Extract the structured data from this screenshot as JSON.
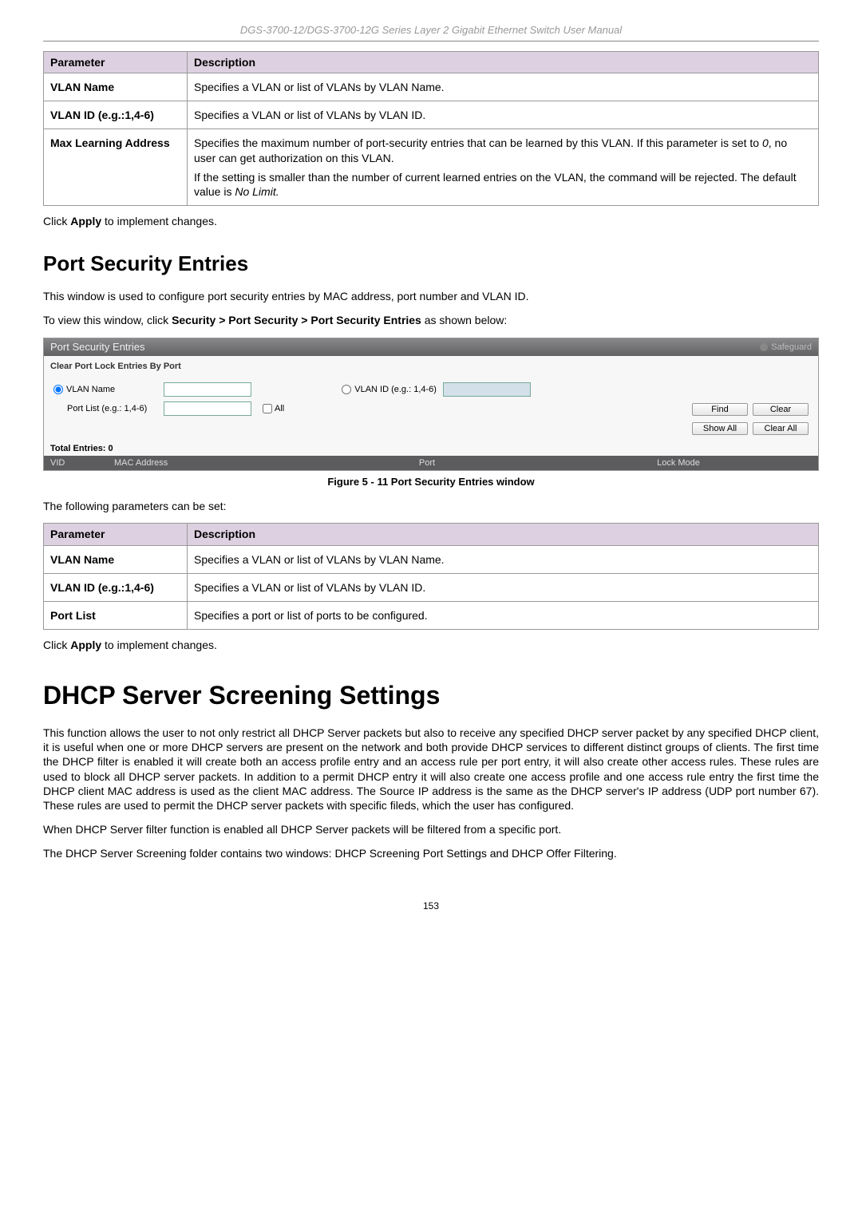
{
  "header": {
    "title": "DGS-3700-12/DGS-3700-12G Series Layer 2 Gigabit Ethernet Switch User Manual"
  },
  "table1": {
    "headers": {
      "p": "Parameter",
      "d": "Description"
    },
    "rows": [
      {
        "param": "VLAN Name",
        "desc1": "Specifies a VLAN or list of VLANs by VLAN Name."
      },
      {
        "param": "VLAN ID (e.g.:1,4-6)",
        "desc1": "Specifies a VLAN or list of VLANs by VLAN ID."
      },
      {
        "param": "Max Learning Address",
        "desc1": "Specifies the maximum number of port-security entries that can be learned by this VLAN. If this parameter is set to ",
        "desc1_italic": "0",
        "desc1_cont": ", no user can get authorization on this VLAN.",
        "desc2": "If the setting is smaller than the number of current learned entries on the VLAN, the command will be rejected. The default value is ",
        "desc2_italic": "No Limit."
      }
    ]
  },
  "apply_text": {
    "pre": "Click ",
    "bold": "Apply",
    "post": " to implement changes."
  },
  "section1": {
    "heading": "Port Security Entries",
    "intro": "This window is used to configure port security entries by MAC address, port number and VLAN ID.",
    "nav_pre": "To view this window, click ",
    "nav_bold": "Security > Port Security > Port Security Entries",
    "nav_post": " as shown below:"
  },
  "ui": {
    "title": "Port Security Entries",
    "safeguard": "Safeguard",
    "sublabel": "Clear Port Lock Entries By Port",
    "vlan_name_label": "VLAN Name",
    "port_list_label": "Port List (e.g.: 1,4-6)",
    "all_label": "All",
    "vlan_id_label": "VLAN ID (e.g.: 1,4-6)",
    "find_btn": "Find",
    "clear_btn": "Clear",
    "showall_btn": "Show All",
    "clearall_btn": "Clear All",
    "total_entries": "Total Entries:  0",
    "cols": {
      "vid": "VID",
      "mac": "MAC Address",
      "port": "Port",
      "lock": "Lock Mode"
    }
  },
  "figure1": "Figure 5 - 11 Port Security Entries window",
  "params_intro": "The following parameters can be set:",
  "table2": {
    "headers": {
      "p": "Parameter",
      "d": "Description"
    },
    "rows": [
      {
        "param": "VLAN Name",
        "desc": "Specifies a VLAN or list of VLANs by VLAN Name."
      },
      {
        "param": "VLAN ID (e.g.:1,4-6)",
        "desc": "Specifies a VLAN or list of VLANs by VLAN ID."
      },
      {
        "param": "Port List",
        "desc": "Specifies a port or list of ports to be configured."
      }
    ]
  },
  "section2": {
    "heading": "DHCP Server Screening Settings",
    "p1": "This function allows the user to not only restrict all DHCP Server packets but also to receive any specified DHCP server packet by any specified DHCP client, it is useful when one or more DHCP servers are present on the network and both provide DHCP services to different distinct groups of clients. The first time the DHCP filter is enabled it will create both an access profile entry and an access rule per port entry, it will also create other access rules. These rules are used to block all DHCP server packets. In addition to a permit DHCP entry it will also create one access profile and one access rule entry the first time the DHCP client MAC address is used as the client MAC address. The Source IP address is the same as the DHCP server's IP address (UDP port number 67). These rules are used to permit the DHCP server packets with specific fileds, which the user has configured.",
    "p2": "When DHCP Server filter function is enabled all DHCP Server packets will be filtered from a specific port.",
    "p3": "The DHCP Server Screening folder contains two windows: DHCP Screening Port Settings and DHCP Offer Filtering."
  },
  "page_number": "153"
}
